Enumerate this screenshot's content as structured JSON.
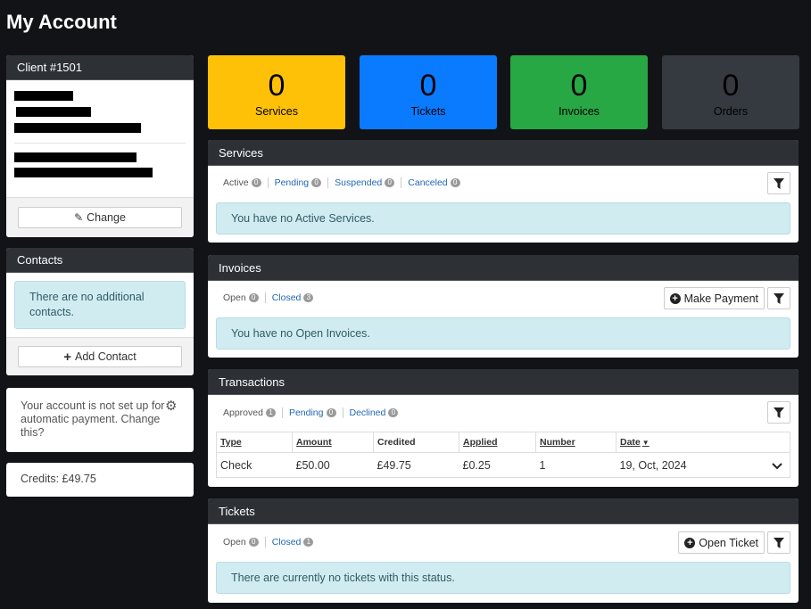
{
  "page": {
    "title": "My Account"
  },
  "client": {
    "header": "Client #1501",
    "change_label": "Change"
  },
  "contacts": {
    "header": "Contacts",
    "empty_message": "There are no additional contacts.",
    "add_label": "Add Contact"
  },
  "autopay": {
    "message": "Your account is not set up for automatic payment. Change this?"
  },
  "credits": {
    "text": "Credits: £49.75"
  },
  "stats": [
    {
      "value": "0",
      "label": "Services",
      "color": "#ffc107"
    },
    {
      "value": "0",
      "label": "Tickets",
      "color": "#0a7bff"
    },
    {
      "value": "0",
      "label": "Invoices",
      "color": "#28a745"
    },
    {
      "value": "0",
      "label": "Orders",
      "color": "#343a40"
    }
  ],
  "services": {
    "header": "Services",
    "filters": [
      {
        "label": "Active",
        "count": "0"
      },
      {
        "label": "Pending",
        "count": "0"
      },
      {
        "label": "Suspended",
        "count": "0"
      },
      {
        "label": "Canceled",
        "count": "0"
      }
    ],
    "message": "You have no Active Services."
  },
  "invoices": {
    "header": "Invoices",
    "filters": [
      {
        "label": "Open",
        "count": "0"
      },
      {
        "label": "Closed",
        "count": "3"
      }
    ],
    "make_payment_label": "Make Payment",
    "message": "You have no Open Invoices."
  },
  "transactions": {
    "header": "Transactions",
    "filters": [
      {
        "label": "Approved",
        "count": "1"
      },
      {
        "label": "Pending",
        "count": "0"
      },
      {
        "label": "Declined",
        "count": "0"
      }
    ],
    "columns": [
      "Type",
      "Amount",
      "Credited",
      "Applied",
      "Number",
      "Date"
    ],
    "rows": [
      {
        "type": "Check",
        "amount": "£50.00",
        "credited": "£49.75",
        "applied": "£0.25",
        "number": "1",
        "date": "19, Oct, 2024"
      }
    ]
  },
  "tickets": {
    "header": "Tickets",
    "filters": [
      {
        "label": "Open",
        "count": "0"
      },
      {
        "label": "Closed",
        "count": "1"
      }
    ],
    "open_ticket_label": "Open Ticket",
    "message": "There are currently no tickets with this status."
  }
}
